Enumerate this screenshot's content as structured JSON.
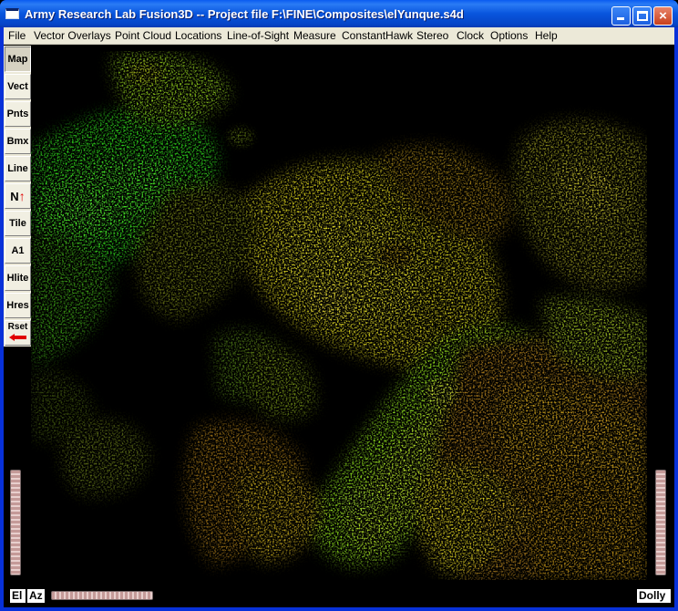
{
  "window": {
    "title": "Army Research Lab Fusion3D -- Project file F:\\FINE\\Composites\\elYunque.s4d",
    "close_glyph": "×"
  },
  "menu": [
    "File",
    "Vector Overlays",
    "Point Cloud",
    "Locations",
    "Line-of-Sight",
    "Measure",
    "ConstantHawk",
    "Stereo",
    "Clock",
    "Options",
    "Help"
  ],
  "toolbar": {
    "map": "Map",
    "vect": "Vect",
    "pnts": "Pnts",
    "bmx": "Bmx",
    "line": "Line",
    "north_letter": "N",
    "north_arrow": "↑",
    "tile": "Tile",
    "a1": "A1",
    "hilite": "Hlite",
    "hres": "Hres",
    "rset": "Rset"
  },
  "controls": {
    "el": "El",
    "az": "Az",
    "dolly": "Dolly"
  },
  "colors": {
    "titlebar": "#0855dd",
    "menubar": "#ece9d8",
    "viewport": "#000000",
    "terrain_bright_green": "#3ee81e",
    "terrain_yellow": "#d6d21e",
    "terrain_olive": "#7a8a1a",
    "terrain_orange": "#b07a1c",
    "slider": "#c49a98"
  }
}
